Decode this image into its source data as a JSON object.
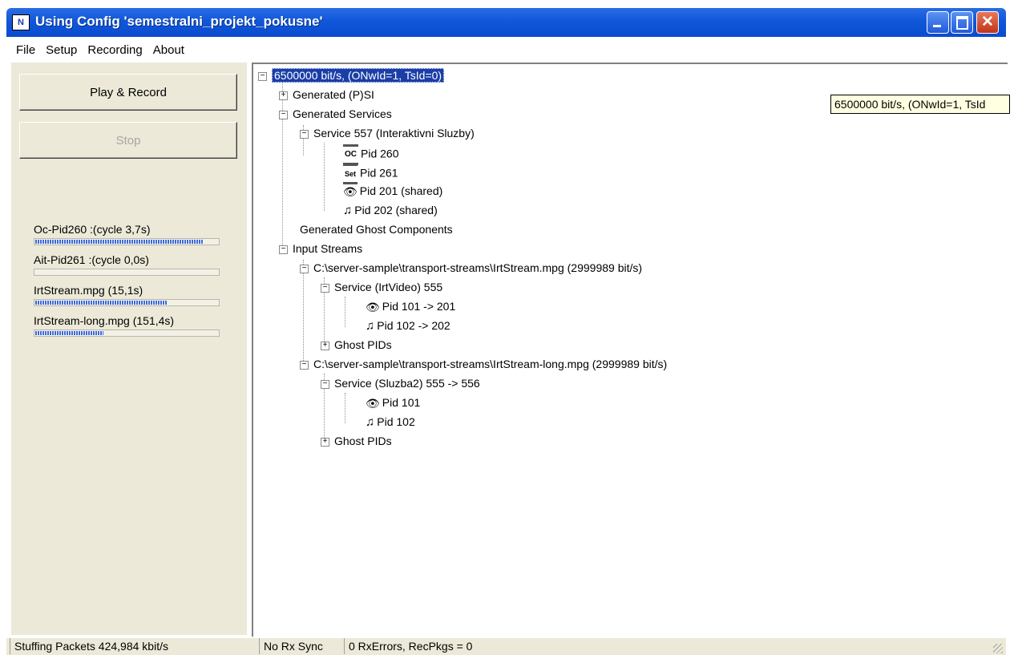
{
  "window": {
    "title": "Using Config 'semestralni_projekt_pokusne'",
    "app_icon_text": "N"
  },
  "menu": [
    "File",
    "Setup",
    "Recording",
    "About"
  ],
  "buttons": {
    "play": "Play & Record",
    "stop": "Stop"
  },
  "progress": [
    {
      "label": "Oc-Pid260 :(cycle 3,7s)",
      "value": 0.92
    },
    {
      "label": "Ait-Pid261 :(cycle 0,0s)",
      "value": 0.0
    },
    {
      "label": "IrtStream.mpg (15,1s)",
      "value": 0.72
    },
    {
      "label": "IrtStream-long.mpg (151,4s)",
      "value": 0.38
    }
  ],
  "tree": {
    "root": "6500000 bit/s, (ONwId=1, TsId=0)",
    "generated_psi": "Generated (P)SI",
    "generated_services": "Generated Services",
    "service_557": "Service 557 (Interaktivni Sluzby)",
    "pid_260": "Pid 260",
    "pid_261": "Pid 261",
    "pid_201_shared": "Pid 201 (shared)",
    "pid_202_shared": "Pid 202 (shared)",
    "generated_ghost": "Generated Ghost Components",
    "input_streams": "Input Streams",
    "stream1": "C:\\server-sample\\transport-streams\\IrtStream.mpg (2999989 bit/s)",
    "service_irtvideo": "Service (IrtVideo) 555",
    "pid_101_201": "Pid 101 -> 201",
    "pid_102_202": "Pid 102 -> 202",
    "ghost_pids_1": "Ghost PIDs",
    "stream2": "C:\\server-sample\\transport-streams\\IrtStream-long.mpg (2999989 bit/s)",
    "service_sluzba2": "Service (Sluzba2) 555 -> 556",
    "pid_101": "Pid 101",
    "pid_102": "Pid 102",
    "ghost_pids_2": "Ghost PIDs"
  },
  "tooltip": "6500000 bit/s, (ONwId=1, TsId",
  "icons": {
    "oc": "OC",
    "set": "Set",
    "eye": "👁",
    "note": "♫"
  },
  "status": {
    "stuffing": "Stuffing Packets 424,984 kbit/s",
    "sync": "No Rx Sync",
    "errors": "0 RxErrors, RecPkgs = 0"
  }
}
